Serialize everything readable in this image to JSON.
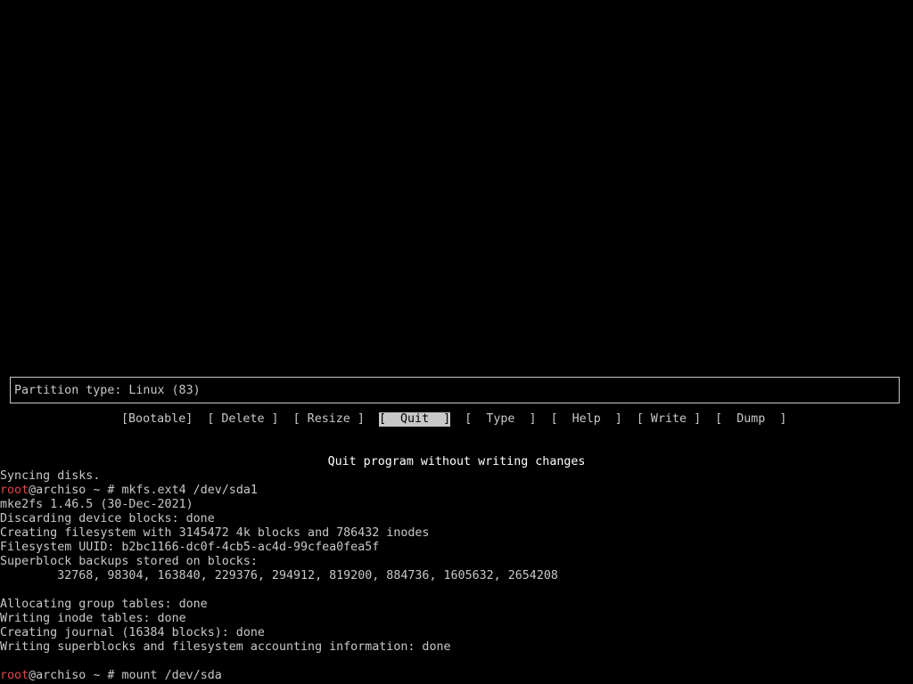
{
  "partition_info": {
    "text": "Partition type: Linux (83)"
  },
  "menu": {
    "items": [
      {
        "label": "[Bootable]"
      },
      {
        "label": "[ Delete ]"
      },
      {
        "label": "[ Resize ]"
      },
      {
        "label": "[  Quit  ]"
      },
      {
        "label": "[  Type  ]"
      },
      {
        "label": "[  Help  ]"
      },
      {
        "label": "[ Write ]"
      },
      {
        "label": "[  Dump  ]"
      }
    ],
    "selected_index": 3
  },
  "hint": "Quit program without writing changes",
  "colors": {
    "background": "#000000",
    "foreground": "#c8c8c8",
    "prompt_user": "#e04848",
    "highlight": "#c8c8c8"
  },
  "terminal": {
    "lines": [
      {
        "text": "Syncing disks."
      },
      {
        "user": "root",
        "host_path": "@archiso ~ # ",
        "cmd": "mkfs.ext4 /dev/sda1"
      },
      {
        "text": "mke2fs 1.46.5 (30-Dec-2021)"
      },
      {
        "text": "Discarding device blocks: done"
      },
      {
        "text": "Creating filesystem with 3145472 4k blocks and 786432 inodes"
      },
      {
        "text": "Filesystem UUID: b2bc1166-dc0f-4cb5-ac4d-99cfea0fea5f"
      },
      {
        "text": "Superblock backups stored on blocks:"
      },
      {
        "text": "        32768, 98304, 163840, 229376, 294912, 819200, 884736, 1605632, 2654208"
      },
      {
        "text": ""
      },
      {
        "text": "Allocating group tables: done"
      },
      {
        "text": "Writing inode tables: done"
      },
      {
        "text": "Creating journal (16384 blocks): done"
      },
      {
        "text": "Writing superblocks and filesystem accounting information: done"
      },
      {
        "text": ""
      },
      {
        "user": "root",
        "host_path": "@archiso ~ # ",
        "cmd": "mount /dev/sda"
      }
    ]
  }
}
